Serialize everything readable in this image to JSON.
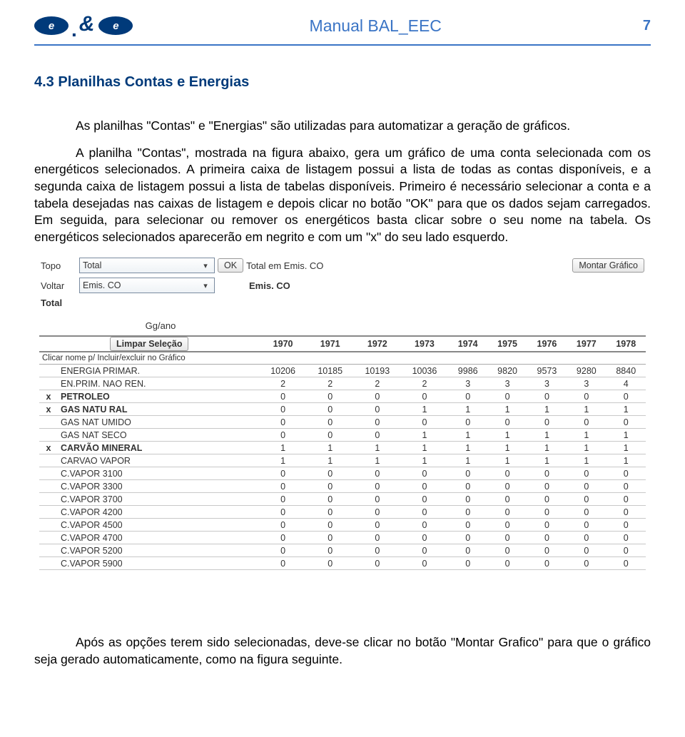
{
  "header": {
    "logo_e": "e",
    "manual_title": "Manual BAL_EEC",
    "page_number": "7"
  },
  "section": {
    "title": "4.3 Planilhas Contas e Energias",
    "p1": "As planilhas \"Contas\" e \"Energias\" são utilizadas para automatizar a geração de gráficos.",
    "p2": "A planilha \"Contas\", mostrada na figura abaixo, gera um gráfico de uma conta selecionada com os energéticos selecionados. A primeira caixa de listagem possui a lista de todas as contas disponíveis, e a segunda caixa de listagem possui a lista de tabelas disponíveis. Primeiro é necessário selecionar a conta e a tabela desejadas nas caixas de listagem e depois clicar no botão \"OK\" para que os dados sejam carregados. Em seguida, para selecionar ou remover os energéticos basta clicar sobre o seu nome na tabela. Os energéticos selecionados aparecerão em negrito e com um \"x\" do seu lado esquerdo.",
    "p3": "Após as opções terem sido selecionadas, deve-se clicar no botão \"Montar Grafico\" para que o gráfico seja gerado automaticamente, como na figura seguinte."
  },
  "screenshot": {
    "labels": {
      "topo": "Topo",
      "voltar": "Voltar",
      "total": "Total",
      "ok": "OK",
      "montar": "Montar Gráfico",
      "limpar": "Limpar Seleção",
      "click_hint": "Clicar nome p/ Incluir/excluir no Gráfico",
      "unit": "Gg/ano",
      "total_emis": "Total em Emis. CO",
      "emis_co_center": "Emis. CO"
    },
    "select_topo": "Total",
    "select_voltar": "Emis. CO",
    "years": [
      "1970",
      "1971",
      "1972",
      "1973",
      "1974",
      "1975",
      "1976",
      "1977",
      "1978"
    ],
    "rows": [
      {
        "mark": "",
        "name": "ENERGIA PRIMAR.",
        "bold": false,
        "vals": [
          "10206",
          "10185",
          "10193",
          "10036",
          "9986",
          "9820",
          "9573",
          "9280",
          "8840"
        ]
      },
      {
        "mark": "",
        "name": "EN.PRIM. NAO REN.",
        "bold": false,
        "vals": [
          "2",
          "2",
          "2",
          "2",
          "3",
          "3",
          "3",
          "3",
          "4"
        ]
      },
      {
        "mark": "x",
        "name": "PETROLEO",
        "bold": true,
        "vals": [
          "0",
          "0",
          "0",
          "0",
          "0",
          "0",
          "0",
          "0",
          "0"
        ]
      },
      {
        "mark": "x",
        "name": "GAS NATU RAL",
        "bold": true,
        "vals": [
          "0",
          "0",
          "0",
          "1",
          "1",
          "1",
          "1",
          "1",
          "1"
        ]
      },
      {
        "mark": "",
        "name": "GAS NAT UMIDO",
        "bold": false,
        "vals": [
          "0",
          "0",
          "0",
          "0",
          "0",
          "0",
          "0",
          "0",
          "0"
        ]
      },
      {
        "mark": "",
        "name": "GAS NAT SECO",
        "bold": false,
        "vals": [
          "0",
          "0",
          "0",
          "1",
          "1",
          "1",
          "1",
          "1",
          "1"
        ]
      },
      {
        "mark": "x",
        "name": "CARVÃO MINERAL",
        "bold": true,
        "vals": [
          "1",
          "1",
          "1",
          "1",
          "1",
          "1",
          "1",
          "1",
          "1"
        ]
      },
      {
        "mark": "",
        "name": "CARVAO VAPOR",
        "bold": false,
        "vals": [
          "1",
          "1",
          "1",
          "1",
          "1",
          "1",
          "1",
          "1",
          "1"
        ]
      },
      {
        "mark": "",
        "name": "C.VAPOR 3100",
        "bold": false,
        "vals": [
          "0",
          "0",
          "0",
          "0",
          "0",
          "0",
          "0",
          "0",
          "0"
        ]
      },
      {
        "mark": "",
        "name": "C.VAPOR 3300",
        "bold": false,
        "vals": [
          "0",
          "0",
          "0",
          "0",
          "0",
          "0",
          "0",
          "0",
          "0"
        ]
      },
      {
        "mark": "",
        "name": "C.VAPOR 3700",
        "bold": false,
        "vals": [
          "0",
          "0",
          "0",
          "0",
          "0",
          "0",
          "0",
          "0",
          "0"
        ]
      },
      {
        "mark": "",
        "name": "C.VAPOR 4200",
        "bold": false,
        "vals": [
          "0",
          "0",
          "0",
          "0",
          "0",
          "0",
          "0",
          "0",
          "0"
        ]
      },
      {
        "mark": "",
        "name": "C.VAPOR 4500",
        "bold": false,
        "vals": [
          "0",
          "0",
          "0",
          "0",
          "0",
          "0",
          "0",
          "0",
          "0"
        ]
      },
      {
        "mark": "",
        "name": "C.VAPOR  4700",
        "bold": false,
        "vals": [
          "0",
          "0",
          "0",
          "0",
          "0",
          "0",
          "0",
          "0",
          "0"
        ]
      },
      {
        "mark": "",
        "name": "C.VAPOR 5200",
        "bold": false,
        "vals": [
          "0",
          "0",
          "0",
          "0",
          "0",
          "0",
          "0",
          "0",
          "0"
        ]
      },
      {
        "mark": "",
        "name": "C.VAPOR 5900",
        "bold": false,
        "vals": [
          "0",
          "0",
          "0",
          "0",
          "0",
          "0",
          "0",
          "0",
          "0"
        ]
      }
    ]
  }
}
